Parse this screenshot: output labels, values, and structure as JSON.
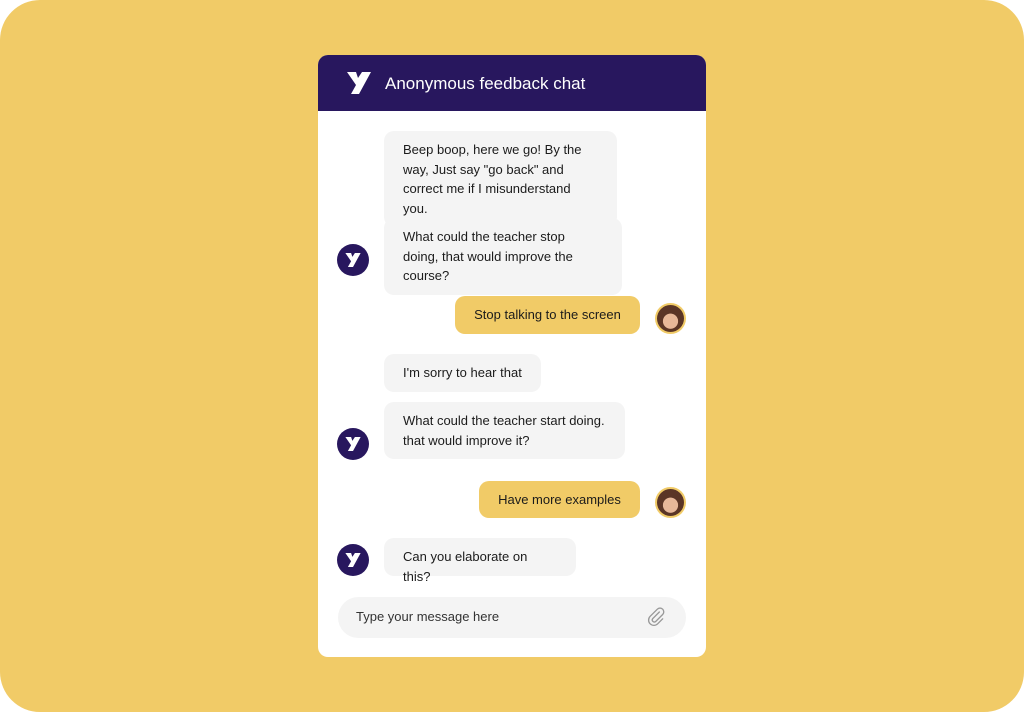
{
  "header": {
    "title": "Anonymous feedback chat",
    "logo_icon": "brand-logo"
  },
  "messages": [
    {
      "sender": "bot",
      "text": "Beep boop, here we go! By the way, Just say \"go back\" and correct me if I misunderstand you."
    },
    {
      "sender": "bot",
      "text": "What could the teacher stop doing, that would improve the course?"
    },
    {
      "sender": "user",
      "text": "Stop talking to the screen"
    },
    {
      "sender": "bot",
      "text": "I'm sorry to hear that"
    },
    {
      "sender": "bot",
      "text": "What could the teacher start doing. that would improve it?"
    },
    {
      "sender": "user",
      "text": "Have more examples"
    },
    {
      "sender": "bot",
      "text": "Can you elaborate on this?"
    }
  ],
  "input": {
    "placeholder": "Type your message here",
    "attach_icon": "paperclip-icon"
  },
  "colors": {
    "background": "#F1CB67",
    "header": "#28175E",
    "bot_bubble": "#F4F4F4",
    "user_bubble": "#F1CB67"
  }
}
